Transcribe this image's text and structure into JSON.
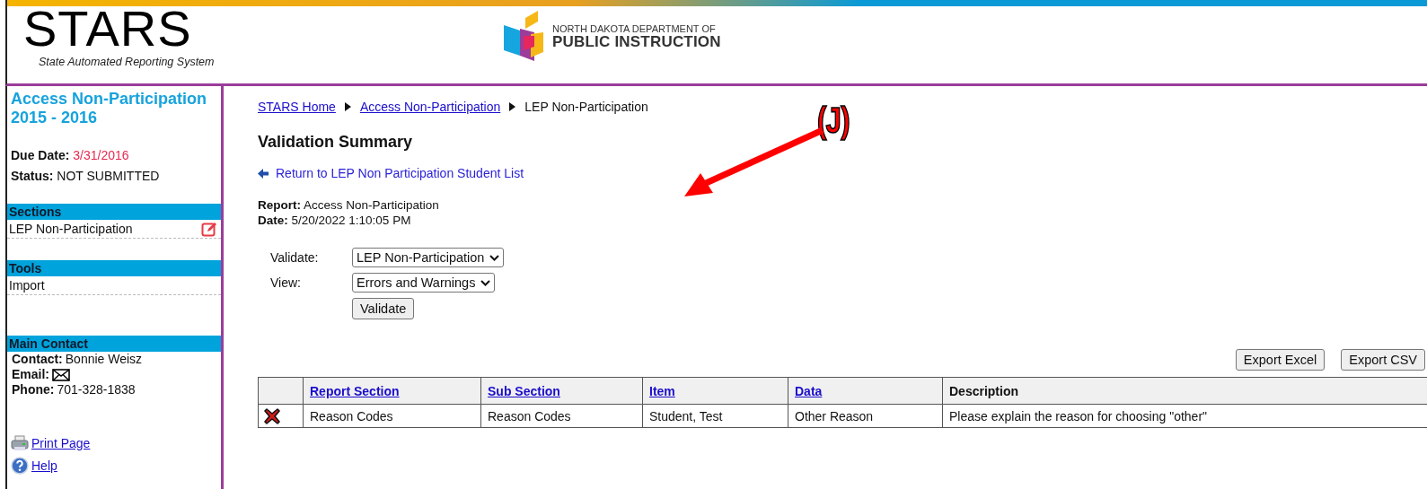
{
  "header": {
    "title": "STARS",
    "subtitle": "State Automated Reporting System",
    "logo_lines": [
      "NORTH DAKOTA DEPARTMENT OF",
      "PUBLIC INSTRUCTION"
    ]
  },
  "sidebar": {
    "report_title": [
      "Access Non-Participation",
      "2015 - 2016"
    ],
    "due_date": {
      "label": "Due Date:",
      "value": "3/31/2016"
    },
    "status": {
      "label": "Status:",
      "value": "NOT SUBMITTED"
    },
    "panels": [
      {
        "heading": "Sections",
        "items": [
          {
            "label": "LEP Non-Participation",
            "editable": true
          }
        ]
      },
      {
        "heading": "Tools",
        "items": [
          {
            "label": "Import",
            "editable": false
          }
        ]
      }
    ],
    "main_contact": {
      "heading": "Main Contact",
      "fields": [
        {
          "kind": "text",
          "label": "Contact:",
          "value": "Bonnie Weisz"
        },
        {
          "kind": "email",
          "label": "Email:"
        },
        {
          "kind": "text",
          "label": "Phone:",
          "value": "701-328-1838"
        }
      ]
    },
    "links": [
      {
        "kind": "print",
        "label": "Print Page"
      },
      {
        "kind": "help",
        "label": "Help"
      }
    ]
  },
  "main": {
    "breadcrumb": [
      {
        "label": "STARS Home",
        "kind": "link"
      },
      {
        "label": "Access Non-Participation",
        "kind": "link"
      },
      {
        "label": "LEP Non-Participation",
        "kind": "current"
      }
    ],
    "title": "Validation Summary",
    "back_link": "Return to LEP Non Participation Student List",
    "report_info": [
      {
        "label": "Report:",
        "value": "Access Non-Participation"
      },
      {
        "label": "Date:",
        "value": "5/20/2022 1:10:05 PM"
      }
    ],
    "form": {
      "fields": [
        {
          "label": "Validate:",
          "value": "LEP Non-Participation"
        },
        {
          "label": "View:",
          "value": "Errors and Warnings"
        }
      ],
      "button": "Validate"
    },
    "export_buttons": [
      "Export Excel",
      "Export CSV"
    ],
    "table": {
      "columns": [
        {
          "label": "Report Section",
          "sortable": true
        },
        {
          "label": "Sub Section",
          "sortable": true
        },
        {
          "label": "Item",
          "sortable": true
        },
        {
          "label": "Data",
          "sortable": true
        },
        {
          "label": "Description",
          "sortable": false
        }
      ],
      "rows": [
        {
          "kind": "error",
          "cells": [
            "Reason Codes",
            "Reason Codes",
            "Student, Test",
            "Other Reason",
            "Please explain the reason for choosing \"other\""
          ]
        }
      ]
    }
  },
  "annotation": {
    "label": "(J)"
  }
}
